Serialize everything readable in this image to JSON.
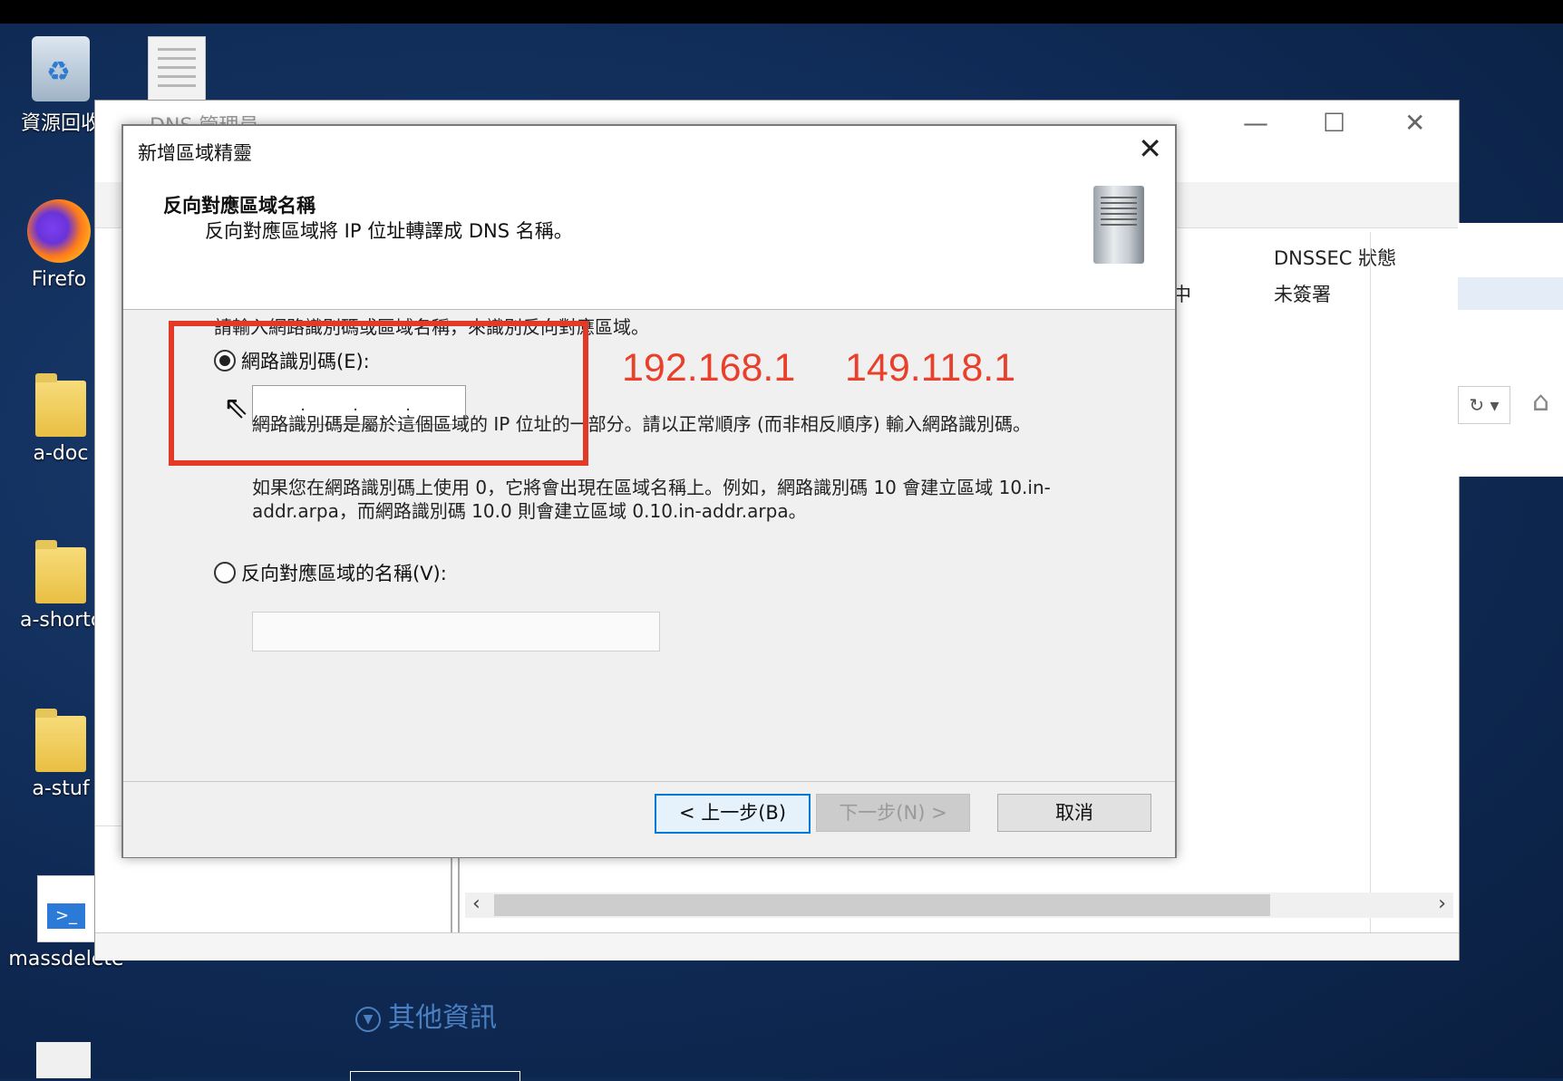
{
  "desktop": {
    "icons": [
      {
        "label": "資源回收",
        "icon": "recycle-bin-icon"
      },
      {
        "label": "Firefo",
        "icon": "firefox-icon"
      },
      {
        "label": "a-doc",
        "icon": "folder-icon"
      },
      {
        "label": "a-shortc",
        "icon": "folder-icon"
      },
      {
        "label": "a-stuf",
        "icon": "folder-icon"
      },
      {
        "label": "massdelete",
        "icon": "powershell-script-icon"
      }
    ]
  },
  "dns_manager": {
    "title": "DNS 管理員",
    "column_header": "DNSSEC 狀態",
    "column_value": "未簽署",
    "col_fragment": "中"
  },
  "wizard": {
    "title": "新增區域精靈",
    "header_title": "反向對應區域名稱",
    "header_subtitle": "反向對應區域將 IP 位址轉譯成 DNS 名稱。",
    "intro": "請輸入網路識別碼或區域名稱，來識別反向對應區域。",
    "option_network_id": "網路識別碼(E):",
    "network_id_value": [
      "",
      "",
      ""
    ],
    "help_1": "網路識別碼是屬於這個區域的 IP 位址的一部分。請以正常順序 (而非相反順序) 輸入網路識別碼。",
    "help_2": "如果您在網路識別碼上使用 0，它將會出現在區域名稱上。例如，網路識別碼 10 會建立區域 10.in-addr.arpa，而網路識別碼 10.0 則會建立區域 0.10.in-addr.arpa。",
    "option_zone_name": "反向對應區域的名稱(V):",
    "zone_name_value": "",
    "back_button": "< 上一步(B)",
    "next_button": "下一步(N) >",
    "cancel_button": "取消"
  },
  "annotation": {
    "ip_1": "192.168.1",
    "ip_2": "149.118.1",
    "color": "#e33a28"
  },
  "server_manager": {
    "other_info": "其他資訊"
  }
}
